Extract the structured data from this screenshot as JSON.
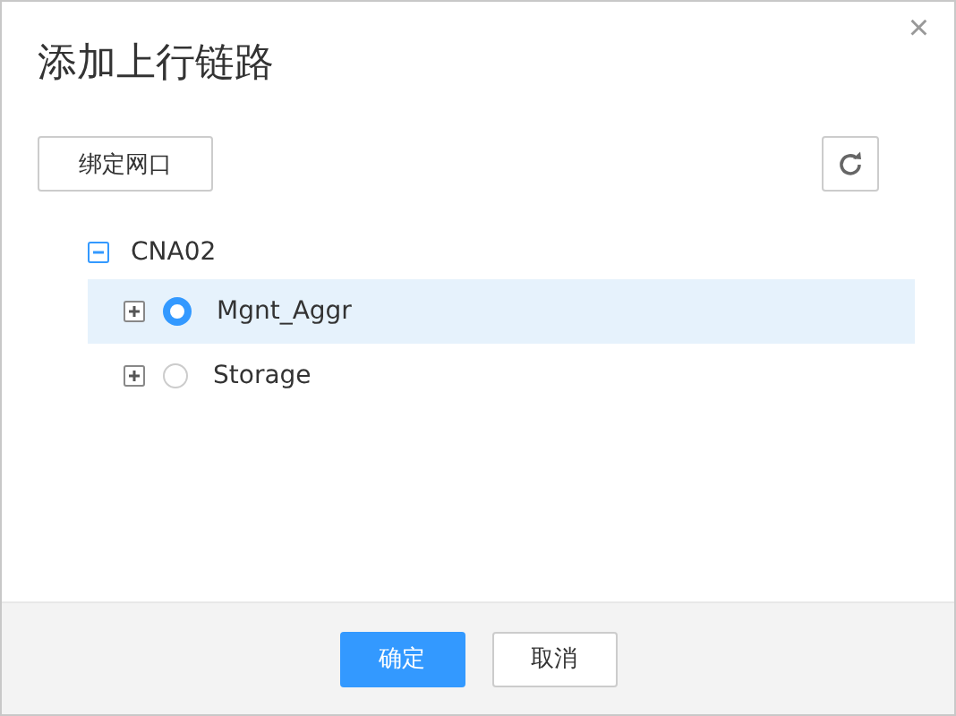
{
  "dialog": {
    "title": "添加上行链路",
    "close": "×"
  },
  "toolbar": {
    "bind_button": "绑定网口"
  },
  "tree": [
    {
      "label": "CNA02",
      "expanded": true,
      "children": [
        {
          "label": "Mgnt_Aggr",
          "expanded": false,
          "selected": true
        },
        {
          "label": "Storage",
          "expanded": false,
          "selected": false
        }
      ]
    }
  ],
  "buttons": [
    {
      "label": "确定",
      "kind": "primary"
    },
    {
      "label": "取消",
      "kind": "default"
    }
  ]
}
